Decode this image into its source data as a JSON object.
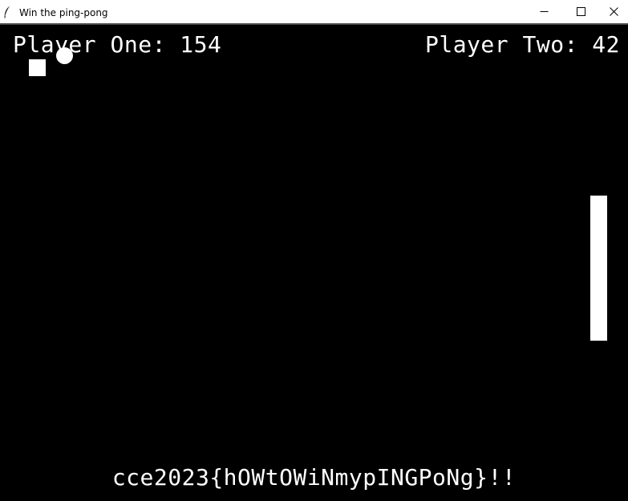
{
  "window": {
    "title": "Win the ping-pong",
    "app_icon": "feather-icon",
    "controls": {
      "minimize_icon": "minimize-icon",
      "maximize_icon": "maximize-icon",
      "close_icon": "close-icon"
    }
  },
  "game": {
    "player_one": {
      "label": "Player One: 154",
      "score": 154
    },
    "player_two": {
      "label": "Player Two: 42",
      "score": 42
    },
    "message": "cce2023{hOWtOWiNmypINGPoNg}!!",
    "colors": {
      "background": "#000000",
      "foreground": "#ffffff"
    }
  }
}
